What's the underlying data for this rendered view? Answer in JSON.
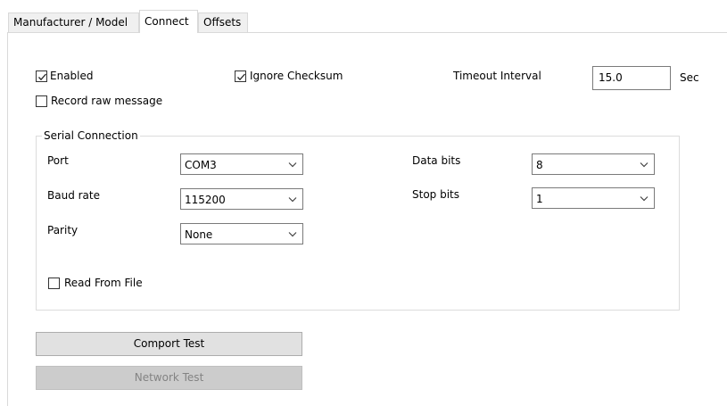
{
  "tabs": [
    {
      "label": "Manufacturer / Model",
      "active": false
    },
    {
      "label": "Connect",
      "active": true
    },
    {
      "label": "Offsets",
      "active": false
    }
  ],
  "options": {
    "enabled": {
      "label": "Enabled",
      "checked": true
    },
    "ignore_checksum": {
      "label": "Ignore Checksum",
      "checked": true
    },
    "record_raw": {
      "label": "Record raw message",
      "checked": false
    }
  },
  "timeout": {
    "label": "Timeout Interval",
    "value": "15.0",
    "unit": "Sec"
  },
  "serial": {
    "title": "Serial Connection",
    "port": {
      "label": "Port",
      "value": "COM3"
    },
    "baud_rate": {
      "label": "Baud rate",
      "value": "115200"
    },
    "parity": {
      "label": "Parity",
      "value": "None"
    },
    "data_bits": {
      "label": "Data bits",
      "value": "8"
    },
    "stop_bits": {
      "label": "Stop bits",
      "value": "1"
    },
    "read_from_file": {
      "label": "Read From File",
      "checked": false
    }
  },
  "buttons": {
    "comport_test": "Comport Test",
    "network_test": "Network Test"
  },
  "icons": {
    "check": "check-icon",
    "dropdown": "chevron-down-icon"
  }
}
